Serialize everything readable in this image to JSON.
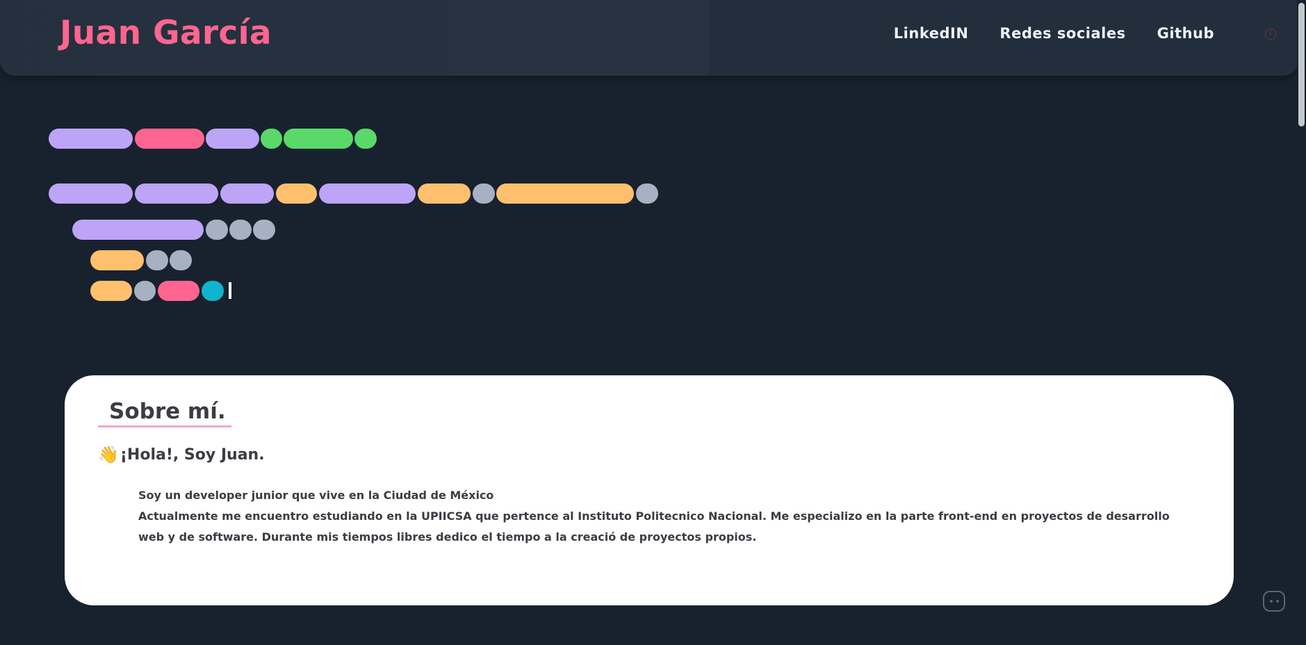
{
  "header": {
    "brand": "Juan García",
    "nav": [
      {
        "label": "LinkedIN"
      },
      {
        "label": "Redes sociales"
      },
      {
        "label": "Github"
      }
    ],
    "info_icon": "info-icon"
  },
  "colors": {
    "background": "#18222e",
    "header": "#222e3c",
    "brand": "#ff6590",
    "purple": "#bda4f6",
    "pink": "#ff6590",
    "green": "#5ad96a",
    "orange": "#ffc06e",
    "gray": "#a6b2c3",
    "cyan": "#0fb5cc"
  },
  "code_skeleton": {
    "lines": [
      [
        "purple",
        "pink",
        "purple",
        "green",
        "green",
        "green"
      ],
      [
        "purple",
        "purple",
        "purple",
        "orange",
        "purple",
        "orange",
        "gray",
        "orange",
        "gray"
      ],
      [
        "purple",
        "gray",
        "gray",
        "gray"
      ],
      [
        "orange",
        "gray",
        "gray"
      ],
      [
        "orange",
        "gray",
        "pink",
        "cyan"
      ]
    ]
  },
  "about": {
    "title": "Sobre mí.",
    "greeting_icon": "waving-hand-icon",
    "greeting": "¡Hola!, Soy Juan.",
    "bio_line1": "Soy un developer junior que vive en la Ciudad de México",
    "bio_line2": "Actualmente me encuentro estudiando en la UPIICSA que pertence al Instituto Politecnico Nacional. Me especializo en la parte front-end en proyectos de desarrollo web y de software. Durante mis tiempos libres dedico el tiempo a la creació de proyectos propios."
  },
  "chat_icon": "chat-bubble-icon"
}
